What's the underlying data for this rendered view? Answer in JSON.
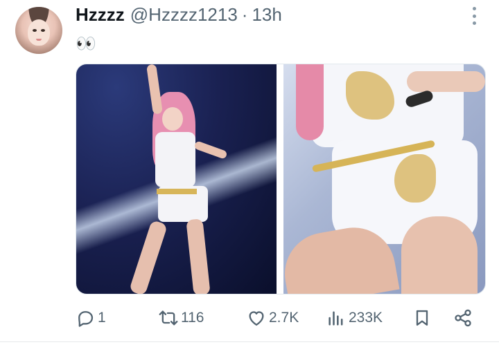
{
  "author": {
    "display_name": "Hzzzz",
    "handle": "@Hzzzz1213",
    "separator": "·",
    "time": "13h"
  },
  "tweet": {
    "text": "👀"
  },
  "media": {
    "count": 2
  },
  "actions": {
    "replies": "1",
    "reposts": "116",
    "likes": "2.7K",
    "views": "233K"
  },
  "icons": {
    "more": "more-vertical-icon",
    "reply": "reply-icon",
    "repost": "repost-icon",
    "like": "heart-icon",
    "views": "views-icon",
    "bookmark": "bookmark-icon",
    "share": "share-icon"
  },
  "colors": {
    "text_primary": "#0f1419",
    "text_secondary": "#536471",
    "border": "#e1e8ed"
  }
}
